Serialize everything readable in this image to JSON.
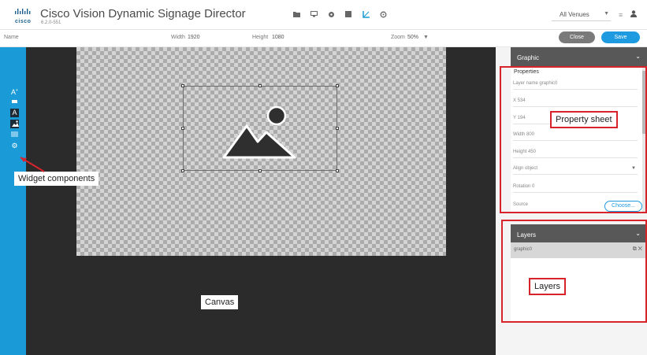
{
  "header": {
    "logo_text": "cisco",
    "app_title": "Cisco Vision Dynamic Signage Director",
    "version": "6.2.0-551",
    "tool_icons": [
      "folder-icon",
      "monitor-icon",
      "gear-icon",
      "grid-icon",
      "crop-icon",
      "settings-icon"
    ],
    "venue_select": "All Venues",
    "menu_icon": "menu-icon",
    "user_icon": "user-icon"
  },
  "toolbar": {
    "name_label": "Name",
    "width_label": "Width",
    "width_value": "1920",
    "height_label": "Height",
    "height_value": "1080",
    "zoom_label": "Zoom",
    "zoom_value": "50%",
    "close_label": "Close",
    "save_label": "Save"
  },
  "widgets": {
    "items": [
      {
        "icon": "text-icon",
        "glyph": "A"
      },
      {
        "icon": "ticker-icon",
        "glyph": "▬"
      },
      {
        "icon": "text-box-icon",
        "glyph": "A"
      },
      {
        "icon": "image-icon",
        "glyph": "▲"
      },
      {
        "icon": "video-icon",
        "glyph": "▦"
      },
      {
        "icon": "settings-icon",
        "glyph": "⚙"
      }
    ]
  },
  "graphic_panel": {
    "header": "Graphic",
    "properties_title": "Properties",
    "layer_name": "Layer name  graphic0",
    "x": "X  534",
    "y": "Y  194",
    "width": "Width  800",
    "height": "Height  450",
    "align": "Align object",
    "rotation": "Rotation  0",
    "source": "Source",
    "choose_label": "Choose..."
  },
  "layers_panel": {
    "header": "Layers",
    "items": [
      {
        "name": "graphic0"
      }
    ]
  },
  "annotations": {
    "widget_components": "Widget components",
    "property_sheet": "Property sheet",
    "layers": "Layers",
    "canvas": "Canvas"
  },
  "colors": {
    "rail_blue": "#1a9bd8",
    "save_blue": "#1e9be0",
    "annotation_red": "#d8232a",
    "canvas_dark": "#2b2b2b",
    "panel_header": "#585858"
  }
}
